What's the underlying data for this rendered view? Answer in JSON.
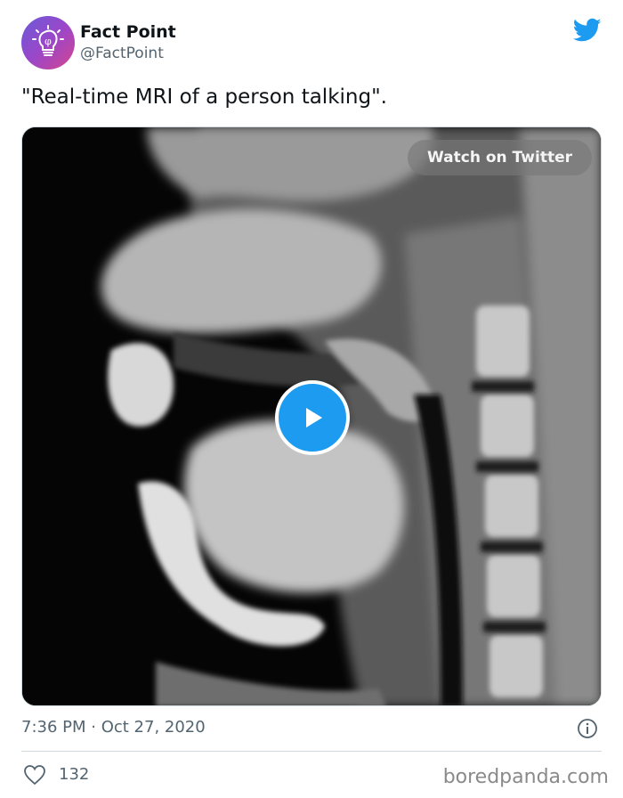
{
  "author": {
    "display_name": "Fact Point",
    "handle": "@FactPoint"
  },
  "tweet": {
    "text": "\"Real-time MRI of a person talking\"."
  },
  "media": {
    "watch_label": "Watch on Twitter"
  },
  "meta": {
    "timestamp": "7:36 PM · Oct 27, 2020",
    "like_count": "132"
  },
  "watermark": "boredpanda.com",
  "colors": {
    "twitter_blue": "#1d9bf0",
    "secondary_text": "#536471"
  },
  "icons": [
    "lightbulb-logo-icon",
    "twitter-bird-icon",
    "play-icon",
    "info-icon",
    "heart-icon"
  ]
}
